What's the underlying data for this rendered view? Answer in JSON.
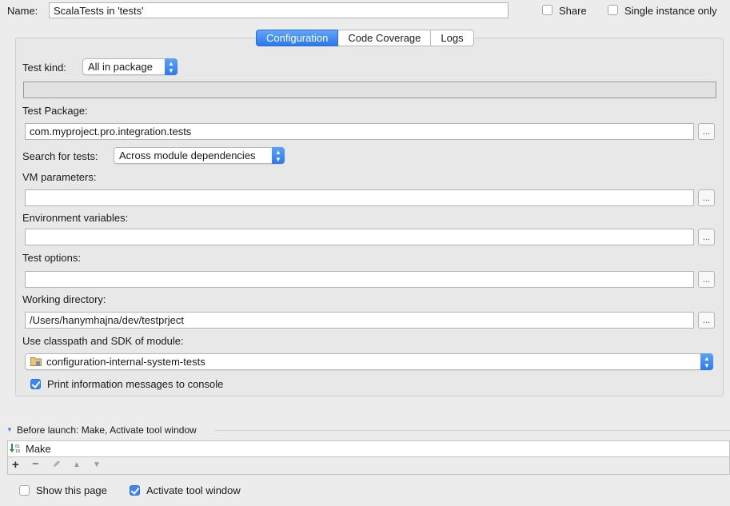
{
  "header": {
    "name_label": "Name:",
    "name_value": "ScalaTests in 'tests'",
    "share_label": "Share",
    "share_checked": false,
    "single_instance_label": "Single instance only",
    "single_instance_checked": false
  },
  "tabs": [
    {
      "label": "Configuration",
      "active": true
    },
    {
      "label": "Code Coverage",
      "active": false
    },
    {
      "label": "Logs",
      "active": false
    }
  ],
  "form": {
    "test_kind_label": "Test kind:",
    "test_kind_value": "All in package",
    "test_package_label": "Test Package:",
    "test_package_value": "com.myproject.pro.integration.tests",
    "search_label": "Search for tests:",
    "search_value": "Across module dependencies",
    "vm_label": "VM parameters:",
    "vm_value": "",
    "env_label": "Environment variables:",
    "env_value": "",
    "test_options_label": "Test options:",
    "test_options_value": "",
    "working_dir_label": "Working directory:",
    "working_dir_value": "/Users/hanymhajna/dev/testprject",
    "module_label": "Use classpath and SDK of module:",
    "module_value": "configuration-internal-system-tests",
    "print_info_label": "Print information messages to console",
    "print_info_checked": true,
    "browse_label": "..."
  },
  "before_launch": {
    "title": "Before launch: Make, Activate tool window",
    "items": [
      "Make"
    ],
    "toolbar": [
      "add-icon",
      "remove-icon",
      "edit-icon",
      "move-up-icon",
      "move-down-icon"
    ]
  },
  "footer": {
    "show_page_label": "Show this page",
    "show_page_checked": false,
    "activate_label": "Activate tool window",
    "activate_checked": true
  },
  "colors": {
    "accent": "#3b87f5",
    "background": "#ececec"
  }
}
